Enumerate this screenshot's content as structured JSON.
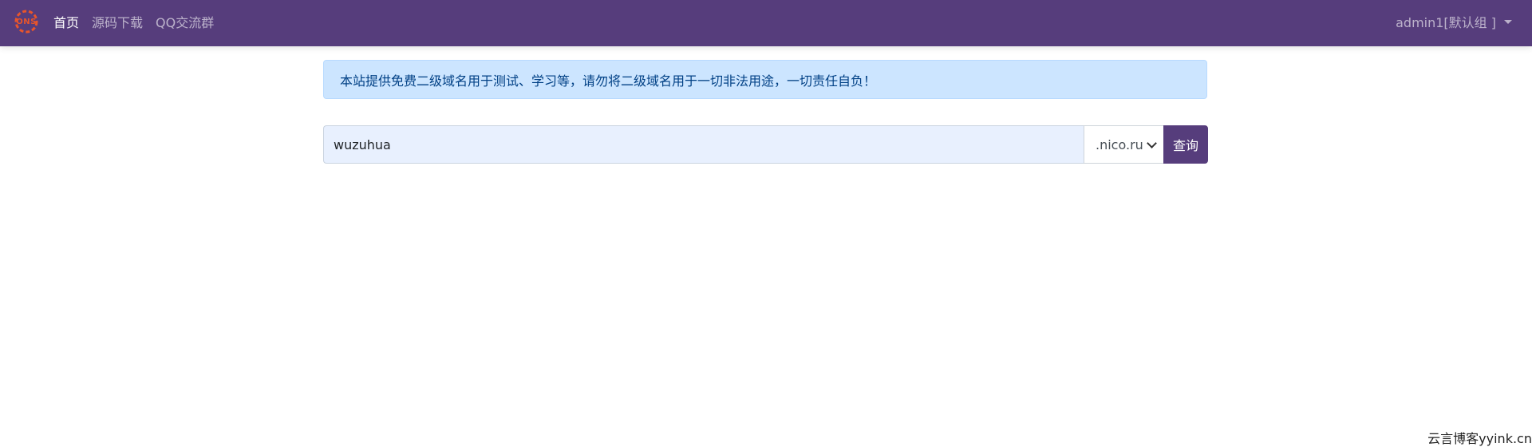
{
  "navbar": {
    "brand_logo": "ONS",
    "links": [
      {
        "label": "首页",
        "active": true
      },
      {
        "label": "源码下载",
        "active": false
      },
      {
        "label": "QQ交流群",
        "active": false
      }
    ],
    "user_menu": "admin1[默认组 ]",
    "background_color": "#563d7c"
  },
  "notice": {
    "text": "本站提供免费二级域名用于测试、学习等，请勿将二级域名用于一切非法用途，一切责任自负！"
  },
  "search": {
    "value": "wuzuhua",
    "placeholder": "",
    "suffix_selected": ".nico.ru",
    "button_label": "查询",
    "button_color": "#563d7c"
  },
  "watermark": {
    "text": "云言博客yyink.cn"
  }
}
